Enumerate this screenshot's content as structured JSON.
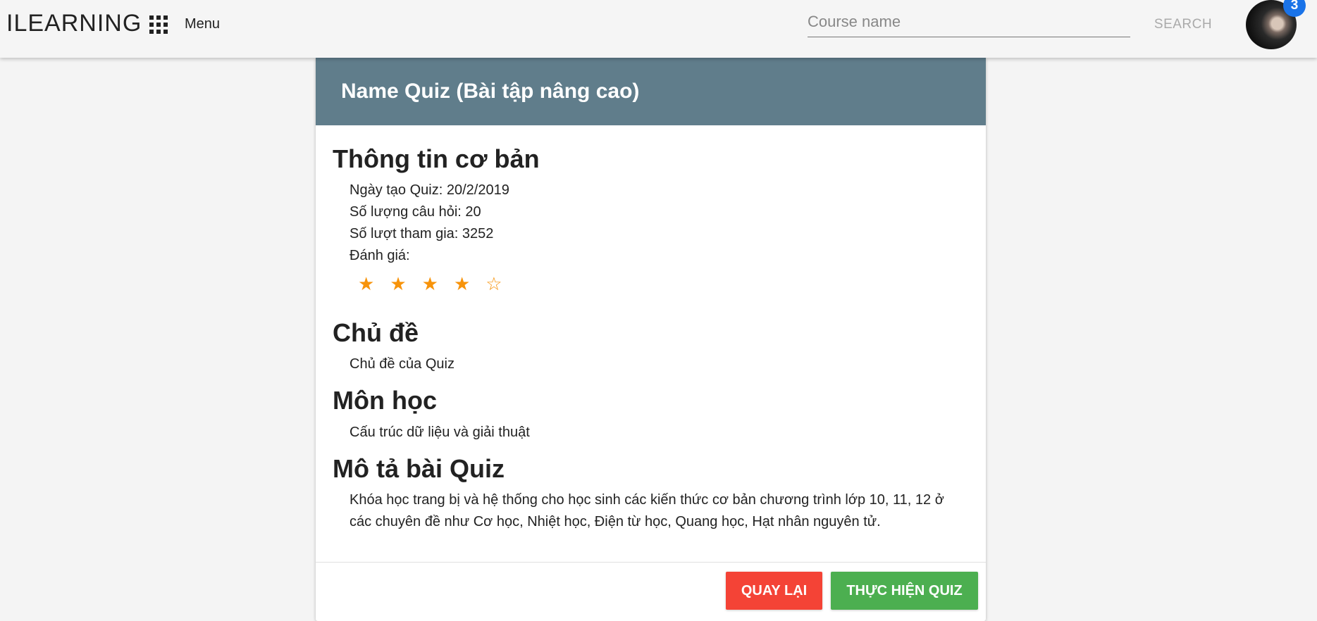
{
  "header": {
    "brand": "ILEARNING",
    "menu_label": "Menu",
    "search_placeholder": "Course name",
    "search_label": "SEARCH",
    "notification_count": "3"
  },
  "quiz": {
    "title": "Name Quiz (Bài tập nâng cao)",
    "basic_info": {
      "heading": "Thông tin cơ bản",
      "created": "Ngày tạo Quiz: 20/2/2019",
      "question_count": "Số lượng câu hỏi: 20",
      "participants": "Số lượt tham gia: 3252",
      "rating_label": "Đánh giá:",
      "rating": 4,
      "rating_max": 5
    },
    "topic": {
      "heading": "Chủ đề",
      "text": "Chủ đề của Quiz"
    },
    "subject": {
      "heading": "Môn học",
      "text": "Cấu trúc dữ liệu và giải thuật"
    },
    "description": {
      "heading": "Mô tả bài Quiz",
      "text": "Khóa học trang bị và hệ thống cho học sinh các kiến thức cơ bản chương trình lớp 10, 11, 12 ở các chuyên đề như Cơ học, Nhiệt học, Điện từ học, Quang học, Hạt nhân nguyên tử."
    }
  },
  "actions": {
    "back_label": "QUAY LẠI",
    "start_label": "THỰC HIỆN QUIZ"
  },
  "colors": {
    "header_bg": "#607d8b",
    "star": "#f7930a",
    "back_button": "#f44336",
    "start_button": "#4caf50",
    "badge": "#1a73e8"
  }
}
